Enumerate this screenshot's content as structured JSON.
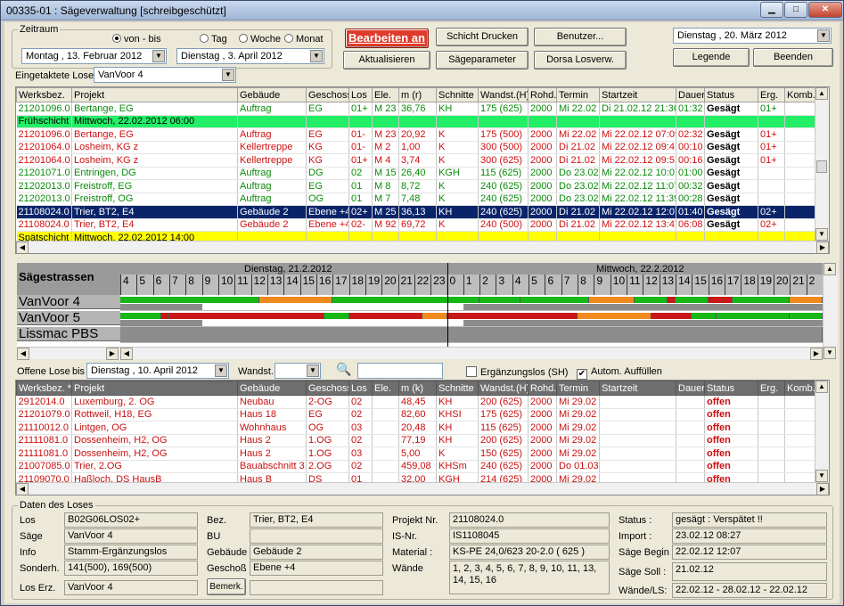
{
  "window": {
    "title": "00335-01 : Sägeverwaltung [schreibgeschützt]"
  },
  "zeitraum": {
    "label": "Zeitraum",
    "radio_vonbis": "von - bis",
    "radio_tag": "Tag",
    "radio_woche": "Woche",
    "radio_monat": "Monat",
    "date_from": "Montag  , 13.  Februar  2012",
    "date_to": "Dienstag  ,  3.   April   2012"
  },
  "toolbar": {
    "bearbeiten": "Bearbeiten an",
    "aktualisieren": "Aktualisieren",
    "schicht_drucken": "Schicht Drucken",
    "saegeparameter": "Sägeparameter",
    "benutzer": "Benutzer...",
    "dorsa": "Dorsa Losverw.",
    "date_current": "Dienstag , 20.    März    2012",
    "legende": "Legende",
    "beenden": "Beenden"
  },
  "eingetaktet": {
    "label": "Eingetaktete Lose",
    "value": "VanVoor 4"
  },
  "columns": [
    "Werksbez.",
    "Projekt",
    "Gebäude",
    "Geschoss",
    "Los",
    "Ele.",
    "m (r)",
    "Schnitte",
    "Wandst.(H)",
    "Rohd.",
    "Termin",
    "Startzeit",
    "Dauer",
    "Status",
    "Erg.",
    "Komb."
  ],
  "columns2": [
    "Werksbez. *",
    "Projekt",
    "Gebäude",
    "Geschoss",
    "Los",
    "Ele.",
    "m (k)",
    "Schnitte",
    "Wandst.(H)",
    "Rohd.",
    "Termin",
    "Startzeit",
    "Dauer",
    "Status",
    "Erg.",
    "Komb."
  ],
  "rows": [
    {
      "c": [
        "21201096.0",
        "Bertange, EG",
        "Auftrag",
        "EG",
        "01+",
        "M 23",
        "36,76",
        "KH",
        "175  (625)",
        "2000",
        "Mi 22.02",
        "Di 21.02.12 21:36",
        "01:32",
        "Gesägt",
        "01+",
        ""
      ],
      "cls": "green"
    },
    {
      "c": [
        "Frühschicht",
        "Mittwoch, 22.02.2012 06:00",
        "",
        "",
        "",
        "",
        "",
        "",
        "",
        "",
        "",
        "",
        "",
        "",
        "",
        ""
      ],
      "cls": "shift-green"
    },
    {
      "c": [
        "21201096.0",
        "Bertange, EG",
        "Auftrag",
        "EG",
        "01-",
        "M 23",
        "20,92",
        "K",
        "175  (500)",
        "2000",
        "Mi 22.02",
        "Mi 22.02.12 07:09",
        "02:32",
        "Gesägt",
        "01+",
        ""
      ],
      "cls": "red"
    },
    {
      "c": [
        "21201064.0",
        "Losheim, KG z",
        "Kellertreppe",
        "KG",
        "01-",
        "M 2",
        "1,00",
        "K",
        "300  (500)",
        "2000",
        "Di 21.02",
        "Mi 22.02.12 09:41",
        "00:10",
        "Gesägt",
        "01+",
        ""
      ],
      "cls": "red"
    },
    {
      "c": [
        "21201064.0",
        "Losheim, KG z",
        "Kellertreppe",
        "KG",
        "01+",
        "M 4",
        "3,74",
        "K",
        "300  (625)",
        "2000",
        "Di 21.02",
        "Mi 22.02.12 09:51",
        "00:16",
        "Gesägt",
        "01+",
        ""
      ],
      "cls": "red"
    },
    {
      "c": [
        "21201071.0",
        "Entringen, DG",
        "Auftrag",
        "DG",
        "02",
        "M 15",
        "26,40",
        "KGH",
        "115  (625)",
        "2000",
        "Do 23.02",
        "Mi 22.02.12 10:07",
        "01:00",
        "Gesägt",
        "",
        ""
      ],
      "cls": "green"
    },
    {
      "c": [
        "21202013.0",
        "Freistroff, EG",
        "Auftrag",
        "EG",
        "01",
        "M 8",
        "8,72",
        "K",
        "240  (625)",
        "2000",
        "Do 23.02",
        "Mi 22.02.12 11:07",
        "00:32",
        "Gesägt",
        "",
        ""
      ],
      "cls": "green"
    },
    {
      "c": [
        "21202013.0",
        "Freistroff, OG",
        "Auftrag",
        "OG",
        "01",
        "M 7",
        "7,48",
        "K",
        "240  (625)",
        "2000",
        "Do 23.02",
        "Mi 22.02.12 11:39",
        "00:28",
        "Gesägt",
        "",
        ""
      ],
      "cls": "green"
    },
    {
      "c": [
        "21108024.0",
        "Trier, BT2, E4",
        "Gebäude 2",
        "Ebene +4",
        "02+",
        "M 25",
        "36,13",
        "KH",
        "240  (625)",
        "2000",
        "Di 21.02",
        "Mi 22.02.12 12:07",
        "01:40",
        "Gesägt",
        "02+",
        ""
      ],
      "cls": "sel"
    },
    {
      "c": [
        "21108024.0",
        "Trier, BT2, E4",
        "Gebäude 2",
        "Ebene +4",
        "02-",
        "M 92",
        "69,72",
        "K",
        "240  (500)",
        "2000",
        "Di 21.02",
        "Mi 22.02.12 13:47",
        "06:08",
        "Gesägt",
        "02+",
        ""
      ],
      "cls": "red"
    },
    {
      "c": [
        "Spätschicht",
        "Mittwoch, 22.02.2012 14:00",
        "",
        "",
        "",
        "",
        "",
        "",
        "",
        "",
        "",
        "",
        "",
        "",
        "",
        ""
      ],
      "cls": "shift-yellow"
    }
  ],
  "gantt": {
    "title": "Sägestrassen",
    "day1": "Dienstag, 21.2.2012",
    "day2": "Mittwoch, 22.2.2012",
    "hours": [
      "4",
      "5",
      "6",
      "7",
      "8",
      "9",
      "10",
      "11",
      "12",
      "13",
      "14",
      "15",
      "16",
      "17",
      "18",
      "19",
      "20",
      "21",
      "22",
      "23",
      "0",
      "1",
      "2",
      "3",
      "4",
      "5",
      "6",
      "7",
      "8",
      "9",
      "10",
      "11",
      "12",
      "13",
      "14",
      "15",
      "16",
      "17",
      "18",
      "19",
      "20",
      "21",
      "2"
    ],
    "lines": [
      {
        "name": "VanVoor 4",
        "segments": [
          [
            0,
            8.5,
            "g"
          ],
          [
            8.5,
            13,
            "o"
          ],
          [
            13,
            22,
            "g"
          ],
          [
            22,
            24.5,
            "g"
          ],
          [
            24.5,
            28.7,
            "g"
          ],
          [
            28.7,
            31.5,
            "o"
          ],
          [
            31.5,
            33.5,
            "g"
          ],
          [
            33.5,
            34,
            "r"
          ],
          [
            34,
            36,
            "g"
          ],
          [
            36,
            37.5,
            "r"
          ],
          [
            37.5,
            41,
            "g"
          ],
          [
            41,
            43,
            "o"
          ]
        ],
        "sub": [
          [
            0,
            5,
            "gr"
          ],
          [
            5,
            21,
            "w"
          ],
          [
            21,
            43,
            "gr"
          ]
        ]
      },
      {
        "name": "VanVoor 5",
        "segments": [
          [
            0,
            2.5,
            "g"
          ],
          [
            2.5,
            3,
            "r"
          ],
          [
            3,
            12.5,
            "r"
          ],
          [
            12.5,
            14,
            "g"
          ],
          [
            14,
            18.5,
            "r"
          ],
          [
            18.5,
            20,
            "o"
          ],
          [
            20,
            28,
            "r"
          ],
          [
            28,
            32.5,
            "o"
          ],
          [
            32.5,
            35,
            "r"
          ],
          [
            35,
            36.5,
            "g"
          ],
          [
            36.5,
            41,
            "g"
          ],
          [
            41,
            43,
            "g"
          ]
        ],
        "sub": [
          [
            0,
            5,
            "gr"
          ],
          [
            5,
            21,
            "w"
          ],
          [
            21,
            43,
            "gr"
          ]
        ]
      },
      {
        "name": "Lissmac PBS",
        "segments": [
          [
            0,
            43,
            "gr"
          ]
        ],
        "sub": []
      }
    ]
  },
  "offene": {
    "label": "Offene Lose",
    "bis": "bis",
    "date": "Dienstag  , 10.    April    2012",
    "wandst": "Wandst.",
    "ergaenzung": "Ergänzungslos (SH)",
    "autom": "Autom. Auffüllen"
  },
  "rows2": [
    [
      "2912014.0",
      "Luxemburg, 2. OG",
      "Neubau",
      "2-OG",
      "02",
      "",
      "48,45",
      "KH",
      "200  (625)",
      "2000",
      "Mi 29.02",
      "",
      "",
      "offen",
      "",
      ""
    ],
    [
      "21201079.0",
      "Rottweil, H18, EG",
      "Haus 18",
      "EG",
      "02",
      "",
      "82,60",
      "KHSI",
      "175  (625)",
      "2000",
      "Mi 29.02",
      "",
      "",
      "offen",
      "",
      ""
    ],
    [
      "21110012.0",
      "Lintgen, OG",
      "Wohnhaus",
      "OG",
      "03",
      "",
      "20,48",
      "KH",
      "115  (625)",
      "2000",
      "Mi 29.02",
      "",
      "",
      "offen",
      "",
      ""
    ],
    [
      "21111081.0",
      "Dossenheim, H2, OG",
      "Haus 2",
      "1.OG",
      "02",
      "",
      "77,19",
      "KH",
      "200  (625)",
      "2000",
      "Mi 29.02",
      "",
      "",
      "offen",
      "",
      ""
    ],
    [
      "21111081.0",
      "Dossenheim, H2, OG",
      "Haus 2",
      "1.OG",
      "03",
      "",
      "5,00",
      "K",
      "150  (625)",
      "2000",
      "Mi 29.02",
      "",
      "",
      "offen",
      "",
      ""
    ],
    [
      "21007085.0",
      "Trier, 2.OG",
      "Bauabschnitt 3",
      "2.OG",
      "02",
      "",
      "459,08",
      "KHSm",
      "240  (625)",
      "2000",
      "Do 01.03",
      "",
      "",
      "offen",
      "",
      ""
    ],
    [
      "21109070.0",
      "Haßloch, DS HausB",
      "Haus B",
      "DS",
      "01",
      "",
      "32,00",
      "KGH",
      "214  (625)",
      "2000",
      "Mi 29.02",
      "",
      "",
      "offen",
      "",
      ""
    ]
  ],
  "details": {
    "label": "Daten des Loses",
    "los_l": "Los",
    "los": "B02G06LOS02+",
    "saege_l": "Säge",
    "saege": "VanVoor 4",
    "info_l": "Info",
    "info": "Stamm-Ergänzungslos",
    "sonderh_l": "Sonderh.",
    "sonderh": "141(500), 169(500)",
    "loserz_l": "Los Erz.",
    "loserz": "VanVoor 4",
    "bez_l": "Bez.",
    "bez": "Trier, BT2, E4",
    "bu_l": "BU",
    "bu": "",
    "gebaeude_l": "Gebäude",
    "gebaeude": "Gebäude 2",
    "geschoss_l": "Geschoß",
    "geschoss": "Ebene +4",
    "bemerk": "Bemerk.",
    "projekt_l": "Projekt Nr.",
    "projekt": "21108024.0",
    "isnr_l": "IS-Nr.",
    "isnr": "IS1108045",
    "material_l": "Material :",
    "material": "KS-PE 24,0/623     20-2.0 ( 625 )",
    "waende_l": "Wände",
    "waende": "1, 2, 3, 4, 5, 6, 7, 8, 9, 10, 11, 13, 14, 15, 16",
    "status_l": "Status :",
    "status": "gesägt             : Verspätet !!",
    "import_l": "Import :",
    "import": "23.02.12   08:27",
    "begin_l": "Säge Begin :",
    "begin": "22.02.12   12:07",
    "soll_l": "Säge Soll :",
    "soll": "21.02.12",
    "wls_l": "Wände/LS:",
    "wls": "22.02.12  - 28.02.12  - 22.02.12"
  }
}
